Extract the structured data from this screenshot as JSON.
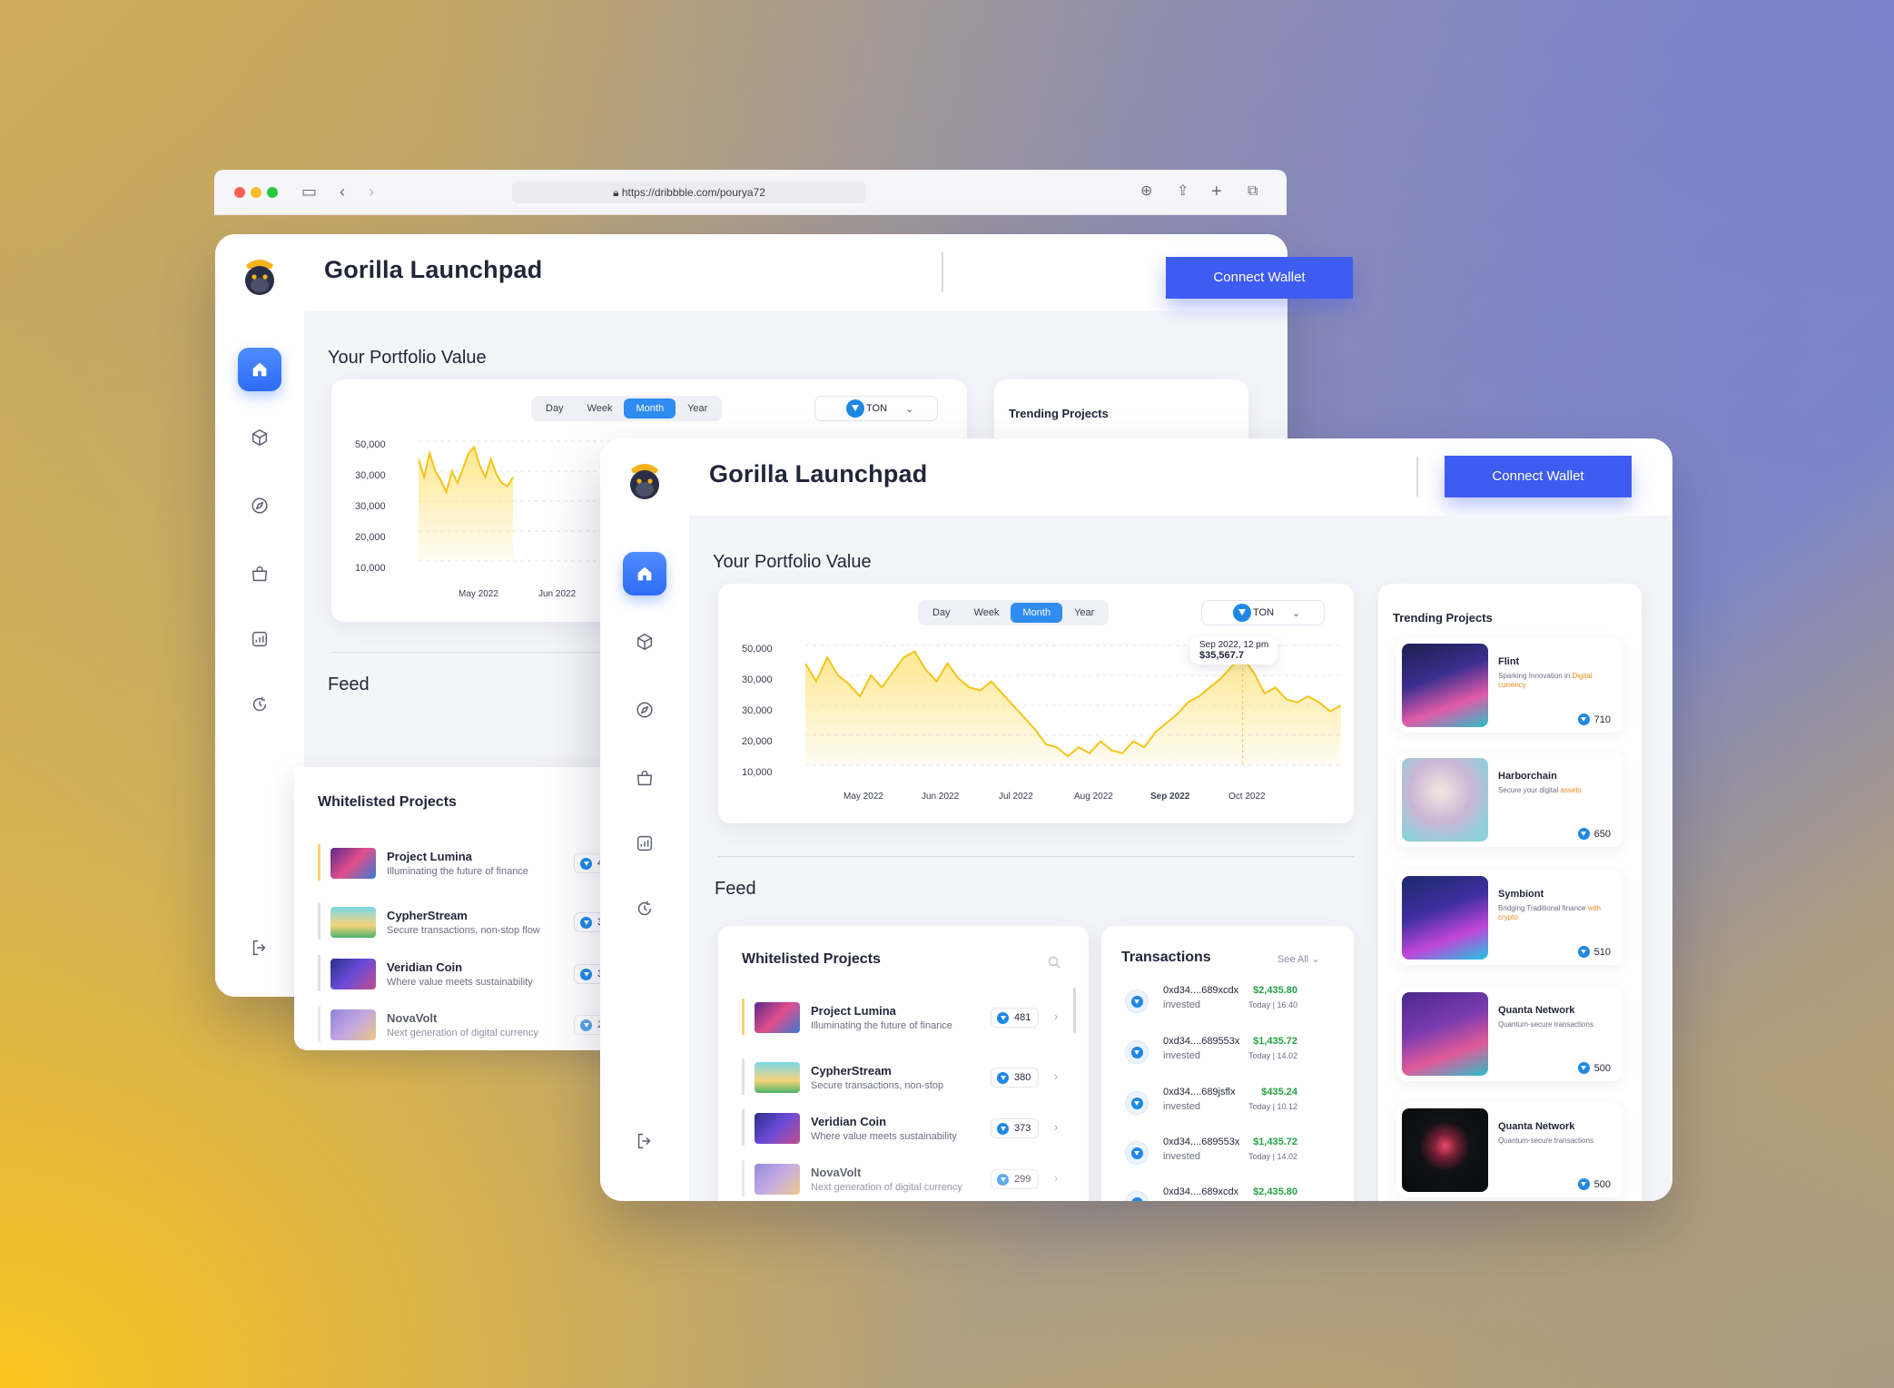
{
  "browser": {
    "url": "https://dribbble.com/pourya72"
  },
  "app": {
    "title": "Gorilla Launchpad",
    "connect_wallet": "Connect Wallet"
  },
  "portfolio": {
    "heading": "Your Portfolio Value",
    "periods": [
      "Day",
      "Week",
      "Month",
      "Year"
    ],
    "selected_period": "Month",
    "currency": "TON"
  },
  "chart_data": {
    "type": "area",
    "yticks": [
      "50,000",
      "30,000",
      "30,000",
      "20,000",
      "10,000"
    ],
    "xticks": [
      "May 2022",
      "Jun 2022",
      "Jul 2022",
      "Aug 2022",
      "Sep 2022",
      "Oct 2022"
    ],
    "ylim": [
      10000,
      50000
    ],
    "x": [
      "May 2022",
      "",
      "",
      "",
      "",
      "",
      "",
      "",
      "",
      "Jun 2022",
      "",
      "",
      "",
      "",
      "",
      "",
      "",
      "",
      "Jul 2022",
      "",
      "",
      "",
      "",
      "",
      "",
      "",
      "",
      "Aug 2022",
      "",
      "",
      "",
      "",
      "",
      "",
      "",
      "",
      "Sep 2022",
      "",
      "",
      "",
      "",
      "",
      "",
      "",
      "",
      "Oct 2022",
      "",
      "",
      ""
    ],
    "series": [
      {
        "values": [
          44000,
          38000,
          46000,
          40000,
          37000,
          33000,
          40000,
          36000,
          41000,
          46000,
          48000,
          42000,
          38000,
          44000,
          39000,
          36000,
          35000,
          38000,
          34000,
          30000,
          26000,
          22000,
          17000,
          16000,
          13000,
          16000,
          14000,
          18000,
          15000,
          14000,
          18000,
          16000,
          21000,
          24000,
          27000,
          31000,
          33000,
          36000,
          39000,
          43000,
          46000,
          41000,
          34000,
          36000,
          32000,
          31000,
          33000,
          31000,
          28000,
          30000
        ]
      }
    ],
    "tooltip": {
      "date": "Sep 2022, 12 pm",
      "value": "$35,567.7"
    },
    "colors": {
      "line": "#f5c518",
      "fill": "#fde68a",
      "marker": "#f0a530"
    }
  },
  "feed": {
    "heading": "Feed"
  },
  "whitelisted": {
    "title": "Whitelisted Projects",
    "items": [
      {
        "name": "Project Lumina",
        "desc": "Illuminating the future of finance",
        "count": "481"
      },
      {
        "name": "CypherStream",
        "desc": "Secure transactions, non-stop",
        "desc_long": "Secure transactions, non-stop flow",
        "count": "380"
      },
      {
        "name": "Veridian Coin",
        "desc": "Where value meets sustainability",
        "count": "373"
      },
      {
        "name": "NovaVolt",
        "desc": "Next generation of digital currency",
        "count": "299"
      }
    ]
  },
  "transactions": {
    "title": "Transactions",
    "see_all": "See All",
    "items": [
      {
        "address": "0xd34....689xcdx",
        "type": "invested",
        "amount": "$2,435.80",
        "time": "Today  |  16.40"
      },
      {
        "address": "0xd34....689553x",
        "type": "invested",
        "amount": "$1,435.72",
        "time": "Today  |  14.02"
      },
      {
        "address": "0xd34....689jsflx",
        "type": "invested",
        "amount": "$435.24",
        "time": "Today  |  10.12"
      },
      {
        "address": "0xd34....689553x",
        "type": "invested",
        "amount": "$1,435.72",
        "time": "Today  |  14.02"
      },
      {
        "address": "0xd34....689xcdx",
        "amount": "$2,435.80"
      }
    ]
  },
  "trending": {
    "title": "Trending Projects",
    "items": [
      {
        "name": "Flint",
        "desc": "Sparking Innovation in",
        "highlight": "Digital currency",
        "count": "710"
      },
      {
        "name": "Harborchain",
        "desc": "Secure your digital",
        "highlight": "assets",
        "count": "650"
      },
      {
        "name": "Symbiont",
        "desc": "Bridging Traditional finance",
        "highlight": "with crypto",
        "count": "510"
      },
      {
        "name": "Quanta Network",
        "desc": "Quantum-secure transactions",
        "count": "500"
      },
      {
        "name": "Quanta Network",
        "desc": "Quantum-secure transactions",
        "count": "500"
      }
    ]
  }
}
